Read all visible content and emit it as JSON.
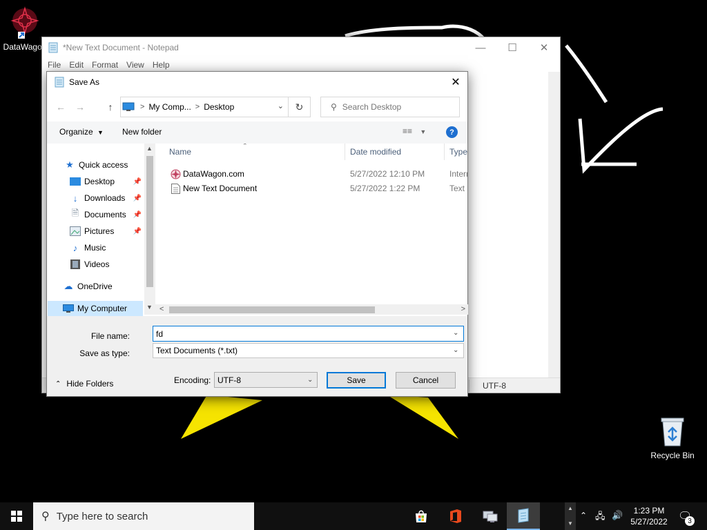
{
  "desktop": {
    "icons": [
      {
        "label": "DataWagon",
        "icon": "datawagon-app-icon"
      },
      {
        "label": "Recycle Bin",
        "icon": "recycle-bin-icon"
      }
    ],
    "background_color": "#000000"
  },
  "notepad": {
    "title": "*New Text Document - Notepad",
    "menu": [
      "File",
      "Edit",
      "Format",
      "View",
      "Help"
    ],
    "status_encoding": "UTF-8"
  },
  "save_as": {
    "title": "Save As",
    "address": {
      "root_icon": "computer-icon",
      "crumbs": [
        "My Comp...",
        "Desktop"
      ]
    },
    "search_placeholder": "Search Desktop",
    "toolbar": {
      "organize": "Organize",
      "new_folder": "New folder"
    },
    "nav_items": [
      {
        "label": "Quick access",
        "icon": "star-icon"
      },
      {
        "label": "Desktop",
        "icon": "desktop-icon",
        "pinned": true
      },
      {
        "label": "Downloads",
        "icon": "download-icon",
        "pinned": true
      },
      {
        "label": "Documents",
        "icon": "document-icon",
        "pinned": true
      },
      {
        "label": "Pictures",
        "icon": "pictures-icon",
        "pinned": true
      },
      {
        "label": "Music",
        "icon": "music-icon"
      },
      {
        "label": "Videos",
        "icon": "video-icon"
      },
      {
        "label": "OneDrive",
        "icon": "cloud-icon"
      },
      {
        "label": "My Computer",
        "icon": "computer-icon",
        "selected": true
      }
    ],
    "columns": [
      "Name",
      "Date modified",
      "Type"
    ],
    "files": [
      {
        "name": "DataWagon.com",
        "date": "5/27/2022 12:10 PM",
        "type": "Intern",
        "icon": "internet-shortcut-icon"
      },
      {
        "name": "New Text Document",
        "date": "5/27/2022 1:22 PM",
        "type": "Text D",
        "icon": "text-file-icon"
      }
    ],
    "file_name_label": "File name:",
    "file_name_value": "fd",
    "save_as_type_label": "Save as type:",
    "save_as_type_value": "Text Documents (*.txt)",
    "hide_folders": "Hide Folders",
    "encoding_label": "Encoding:",
    "encoding_value": "UTF-8",
    "save_button": "Save",
    "cancel_button": "Cancel"
  },
  "taskbar": {
    "search_placeholder": "Type here to search",
    "apps": [
      "microsoft-store-icon",
      "office-icon",
      "network-computer-icon",
      "notepad-icon"
    ],
    "time": "1:23 PM",
    "date": "5/27/2022",
    "notification_count": "3"
  },
  "colors": {
    "accent": "#0078d7",
    "selection": "#cce8ff",
    "taskbar": "#101010"
  }
}
